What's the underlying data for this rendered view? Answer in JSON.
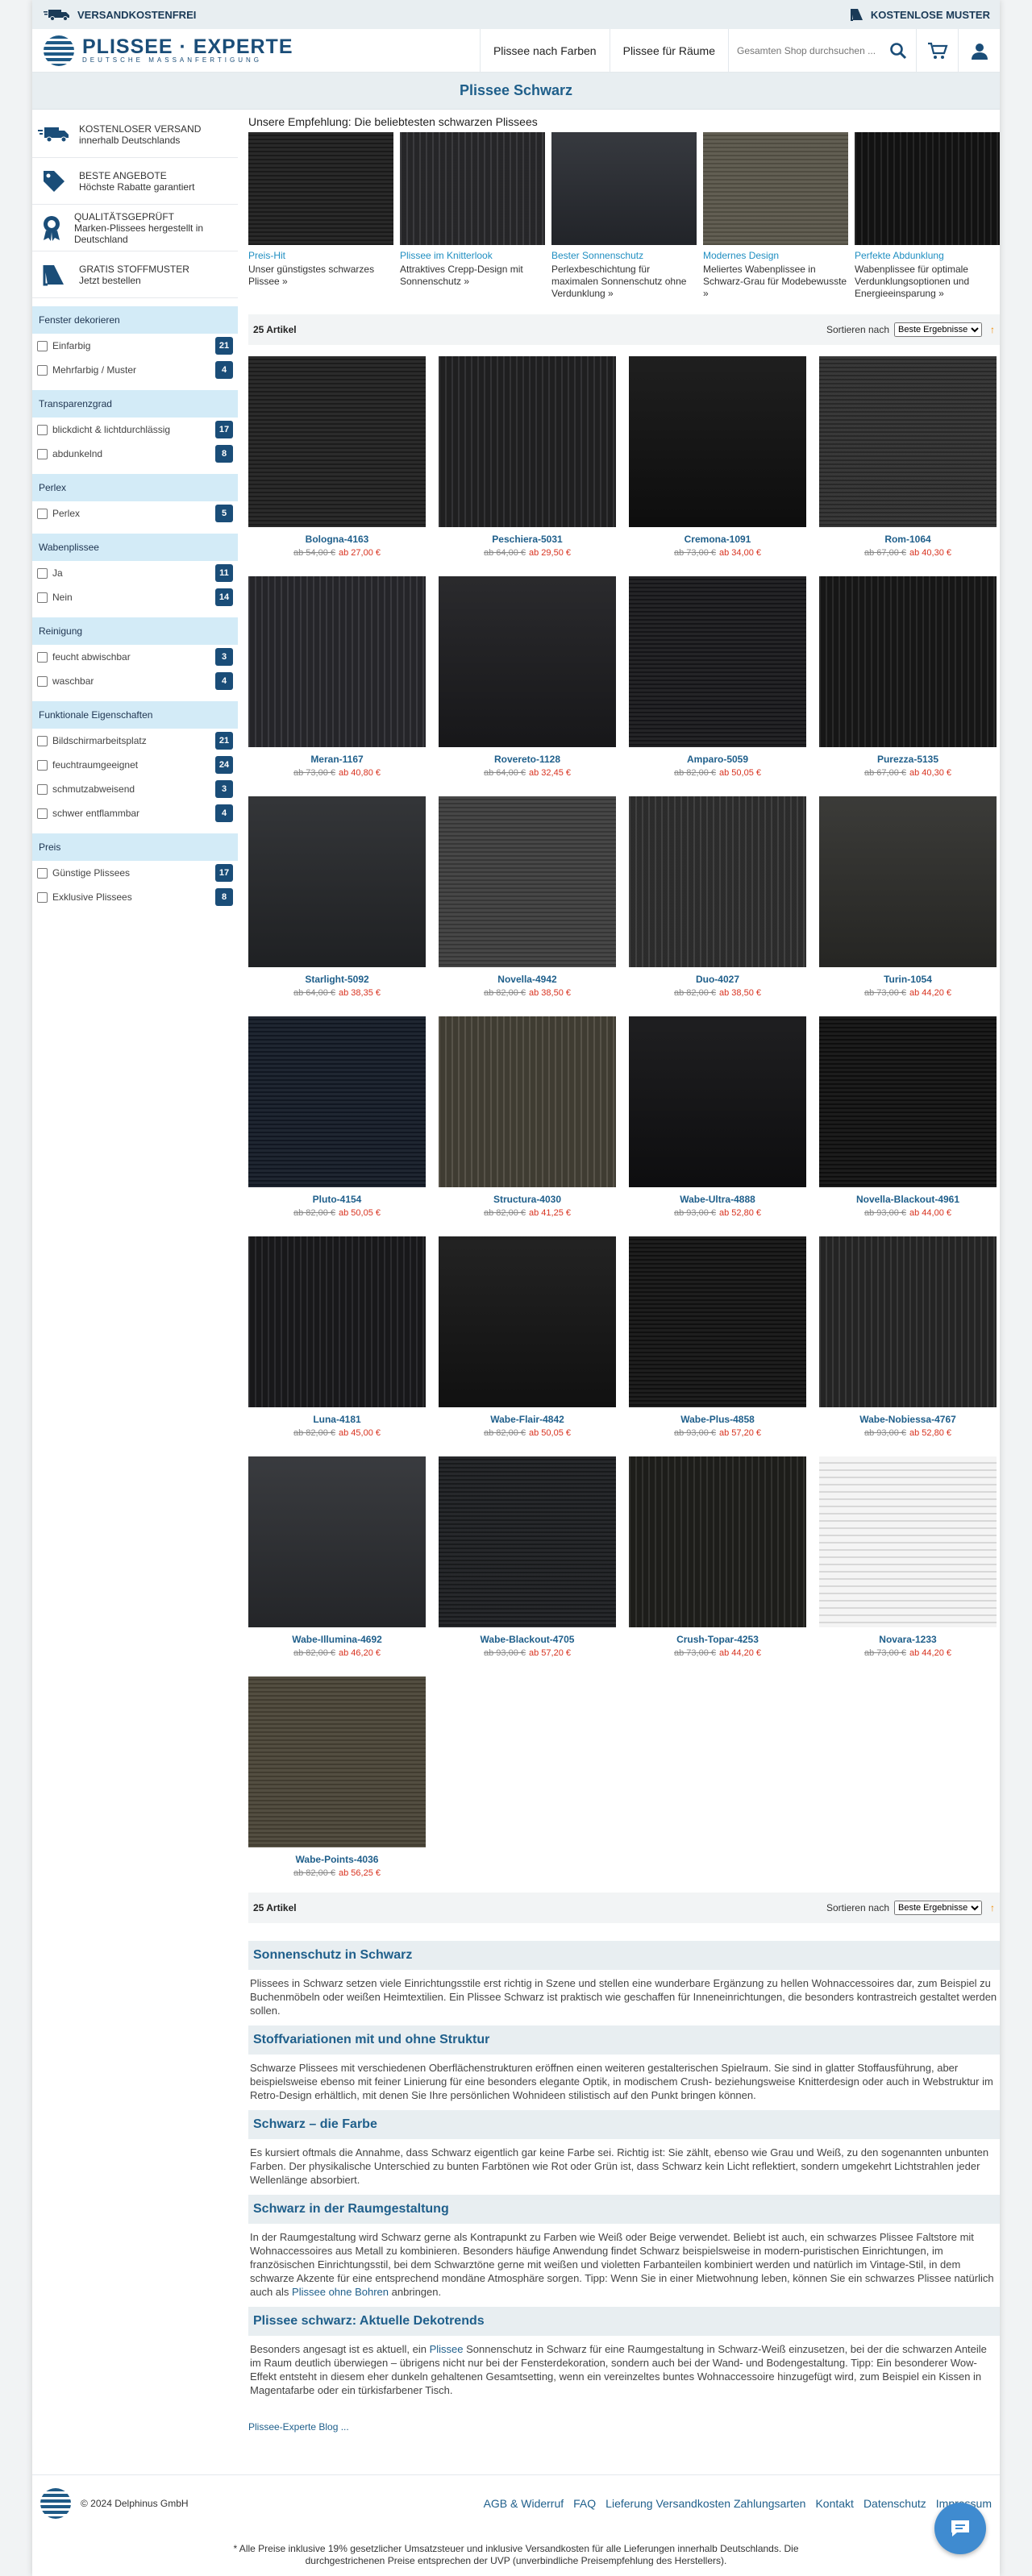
{
  "topbar": {
    "left": "VERSANDKOSTENFREI",
    "right": "KOSTENLOSE MUSTER"
  },
  "logo": {
    "name": "PLISSEE · EXPERTE",
    "tagline": "DEUTSCHE MASSANFERTIGUNG"
  },
  "nav": {
    "colors": "Plissee nach Farben",
    "rooms": "Plissee für Räume"
  },
  "search": {
    "placeholder": "Gesamten Shop durchsuchen ..."
  },
  "icons": [
    "truck-icon",
    "tag-icon",
    "badge-icon",
    "swatch-book-icon",
    "search-icon",
    "cart-icon",
    "user-icon",
    "chat-icon"
  ],
  "page_title": "Plissee Schwarz",
  "usps": [
    {
      "title": "KOSTENLOSER VERSAND",
      "sub": "innerhalb Deutschlands"
    },
    {
      "title": "BESTE ANGEBOTE",
      "sub": "Höchste Rabatte garantiert"
    },
    {
      "title": "QUALITÄTSGEPRÜFT",
      "sub": "Marken-Plissees hergestellt in Deutschland"
    },
    {
      "title": "GRATIS STOFFMUSTER",
      "sub": "Jetzt bestellen"
    }
  ],
  "filters": [
    {
      "title": "Fenster dekorieren",
      "items": [
        {
          "label": "Einfarbig",
          "count": "21"
        },
        {
          "label": "Mehrfarbig / Muster",
          "count": "4"
        }
      ]
    },
    {
      "title": "Transparenzgrad",
      "items": [
        {
          "label": "blickdicht & lichtdurchlässig",
          "count": "17"
        },
        {
          "label": "abdunkelnd",
          "count": "8"
        }
      ]
    },
    {
      "title": "Perlex",
      "items": [
        {
          "label": "Perlex",
          "count": "5"
        }
      ]
    },
    {
      "title": "Wabenplissee",
      "items": [
        {
          "label": "Ja",
          "count": "11"
        },
        {
          "label": "Nein",
          "count": "14"
        }
      ]
    },
    {
      "title": "Reinigung",
      "items": [
        {
          "label": "feucht abwischbar",
          "count": "3"
        },
        {
          "label": "waschbar",
          "count": "4"
        }
      ]
    },
    {
      "title": "Funktionale Eigenschaften",
      "items": [
        {
          "label": "Bildschirmarbeitsplatz",
          "count": "21"
        },
        {
          "label": "feuchtraumgeeignet",
          "count": "24"
        },
        {
          "label": "schmutzabweisend",
          "count": "3"
        },
        {
          "label": "schwer entflammbar",
          "count": "4"
        }
      ]
    },
    {
      "title": "Preis",
      "items": [
        {
          "label": "Günstige Plissees",
          "count": "17"
        },
        {
          "label": "Exklusive Plissees",
          "count": "8"
        }
      ]
    }
  ],
  "recommend": {
    "heading": "Unsere Empfehlung: Die beliebtesten schwarzen Plissees",
    "items": [
      {
        "title": "Preis-Hit",
        "desc": "Unser günstigstes schwarzes Plissee »",
        "swatch": "#1e1e1e"
      },
      {
        "title": "Plissee im Knitterlook",
        "desc": "Attraktives Crepp-Design mit Sonnenschutz »",
        "swatch": "#2c2c2f"
      },
      {
        "title": "Bester Sonnenschutz",
        "desc": "Perlexbeschichtung für maximalen Sonnenschutz ohne Verdunklung »",
        "swatch": "#2a2d33"
      },
      {
        "title": "Modernes Design",
        "desc": "Meliertes Wabenplissee in Schwarz-Grau für Modebewusste »",
        "swatch": "#5a564a"
      },
      {
        "title": "Perfekte Abdunklung",
        "desc": "Wabenplissee für optimale Verdunklungsoptionen und Energieeinsparung »",
        "swatch": "#151515"
      }
    ]
  },
  "toolbar": {
    "count": "25 Artikel",
    "sort_label": "Sortieren nach",
    "sort_value": "Beste Ergebnisse",
    "arrow": "↑"
  },
  "products": [
    {
      "name": "Bologna-4163",
      "old": "ab 54,00 €",
      "new": "ab 27,00 €",
      "swatch": "#202020"
    },
    {
      "name": "Peschiera-5031",
      "old": "ab 64,00 €",
      "new": "ab 29,50 €",
      "swatch": "#242426"
    },
    {
      "name": "Cremona-1091",
      "old": "ab 73,00 €",
      "new": "ab 34,00 €",
      "swatch": "#111111"
    },
    {
      "name": "Rom-1064",
      "old": "ab 67,00 €",
      "new": "ab 40,30 €",
      "swatch": "#2e2e2e"
    },
    {
      "name": "Meran-1167",
      "old": "ab 73,00 €",
      "new": "ab 40,80 €",
      "swatch": "#2b2b30"
    },
    {
      "name": "Rovereto-1128",
      "old": "ab 64,00 €",
      "new": "ab 32,45 €",
      "swatch": "#1d1d20"
    },
    {
      "name": "Amparo-5059",
      "old": "ab 82,00 €",
      "new": "ab 50,05 €",
      "swatch": "#18181b"
    },
    {
      "name": "Purezza-5135",
      "old": "ab 67,00 €",
      "new": "ab 40,30 €",
      "swatch": "#1a1a1a"
    },
    {
      "name": "Starlight-5092",
      "old": "ab 64,00 €",
      "new": "ab 38,35 €",
      "swatch": "#27292c"
    },
    {
      "name": "Novella-4942",
      "old": "ab 82,00 €",
      "new": "ab 38,50 €",
      "swatch": "#3d3d3d"
    },
    {
      "name": "Duo-4027",
      "old": "ab 82,00 €",
      "new": "ab 38,50 €",
      "swatch": "#333333"
    },
    {
      "name": "Turin-1054",
      "old": "ab 73,00 €",
      "new": "ab 44,20 €",
      "swatch": "#2f2f2c"
    },
    {
      "name": "Pluto-4154",
      "old": "ab 82,00 €",
      "new": "ab 50,05 €",
      "swatch": "#131a26"
    },
    {
      "name": "Structura-4030",
      "old": "ab 82,00 €",
      "new": "ab 41,25 €",
      "swatch": "#4a463b"
    },
    {
      "name": "Wabe-Ultra-4888",
      "old": "ab 93,00 €",
      "new": "ab 52,80 €",
      "swatch": "#111113"
    },
    {
      "name": "Novella-Blackout-4961",
      "old": "ab 93,00 €",
      "new": "ab 44,00 €",
      "swatch": "#101010"
    },
    {
      "name": "Luna-4181",
      "old": "ab 82,00 €",
      "new": "ab 45,00 €",
      "swatch": "#1c1c1f"
    },
    {
      "name": "Wabe-Flair-4842",
      "old": "ab 82,00 €",
      "new": "ab 50,05 €",
      "swatch": "#151515"
    },
    {
      "name": "Wabe-Plus-4858",
      "old": "ab 93,00 €",
      "new": "ab 57,20 €",
      "swatch": "#121212"
    },
    {
      "name": "Wabe-Nobiessa-4767",
      "old": "ab 93,00 €",
      "new": "ab 52,80 €",
      "swatch": "#2a2a2a"
    },
    {
      "name": "Wabe-Illumina-4692",
      "old": "ab 82,00 €",
      "new": "ab 46,20 €",
      "swatch": "#2d2f33"
    },
    {
      "name": "Wabe-Blackout-4705",
      "old": "ab 93,00 €",
      "new": "ab 57,20 €",
      "swatch": "#1b1d20"
    },
    {
      "name": "Crush-Topar-4253",
      "old": "ab 73,00 €",
      "new": "ab 44,20 €",
      "swatch": "#22221f"
    },
    {
      "name": "Novara-1233",
      "old": "ab 73,00 €",
      "new": "ab 44,20 €",
      "swatch": "#e8e8e8"
    },
    {
      "name": "Wabe-Points-4036",
      "old": "ab 82,00 €",
      "new": "ab 56,25 €",
      "swatch": "#4a4437"
    }
  ],
  "sections": [
    {
      "title": "Sonnenschutz in Schwarz",
      "text": "Plissees in Schwarz setzen viele Einrichtungsstile erst richtig in Szene und stellen eine wunderbare Ergänzung zu hellen Wohnaccessoires dar, zum Beispiel zu Buchenmöbeln oder weißen Heimtextilien. Ein Plissee Schwarz ist praktisch wie geschaffen für Inneneinrichtungen, die besonders kontrastreich gestaltet werden sollen."
    },
    {
      "title": "Stoffvariationen mit und ohne Struktur",
      "text": "Schwarze Plissees mit verschiedenen Oberflächenstrukturen eröffnen einen weiteren gestalterischen Spielraum. Sie sind in glatter Stoffausführung, aber beispielsweise ebenso mit feiner Linierung für eine besonders elegante Optik, in modischem Crush- beziehungsweise Knitterdesign oder auch in Webstruktur im Retro-Design erhältlich, mit denen Sie Ihre persönlichen Wohnideen stilistisch auf den Punkt bringen können."
    },
    {
      "title": "Schwarz – die Farbe",
      "text": "Es kursiert oftmals die Annahme, dass Schwarz eigentlich gar keine Farbe sei. Richtig ist: Sie zählt, ebenso wie Grau und Weiß, zu den sogenannten unbunten Farben. Der physikalische Unterschied zu bunten Farbtönen wie Rot oder Grün ist, dass Schwarz kein Licht reflektiert, sondern umgekehrt Lichtstrahlen jeder Wellenlänge absorbiert."
    },
    {
      "title": "Schwarz in der Raumgestaltung",
      "text_a": "In der Raumgestaltung wird Schwarz gerne als Kontrapunkt zu Farben wie Weiß oder Beige verwendet. Beliebt ist auch, ein schwarzes Plissee Faltstore mit Wohnaccessoires aus Metall zu kombinieren. Besonders häufige Anwendung findet Schwarz beispielsweise in modern-puristischen Einrichtungen, im französischen Einrichtungsstil, bei dem Schwarztöne gerne mit weißen und violetten Farbanteilen kombiniert werden und natürlich im Vintage-Stil, in dem schwarze Akzente für eine entsprechend mondäne Atmosphäre sorgen. Tipp: Wenn Sie in einer Mietwohnung leben, können Sie ein schwarzes Plissee natürlich auch als",
      "link": "Plissee ohne Bohren",
      "text_b": "anbringen."
    },
    {
      "title": "Plissee schwarz: Aktuelle Dekotrends",
      "text_a": "Besonders angesagt ist es aktuell, ein",
      "link": "Plissee",
      "text_b": "Sonnenschutz in Schwarz für eine Raumgestaltung in Schwarz-Weiß einzusetzen, bei der die schwarzen Anteile im Raum deutlich überwiegen – übrigens nicht nur bei der Fensterdekoration, sondern auch bei der Wand- und Bodengestaltung. Tipp: Ein besonderer Wow-Effekt entsteht in diesem eher dunkeln gehaltenen Gesamtsetting, wenn ein vereinzeltes buntes Wohnaccessoire hinzugefügt wird, zum Beispiel ein Kissen in Magentafarbe oder ein türkisfarbener Tisch."
    }
  ],
  "blog_link": "Plissee-Experte Blog ...",
  "footer": {
    "copyright": "© 2024 Delphinus GmbH",
    "links": [
      "AGB & Widerruf",
      "FAQ",
      "Lieferung Versandkosten Zahlungsarten",
      "Kontakt",
      "Datenschutz",
      "Impressum"
    ],
    "legal_1": "* Alle Preise inklusive 19% gesetzlicher Umsatzsteuer und inklusive Versandkosten für alle Lieferungen innerhalb Deutschlands. Die",
    "legal_2": "durchgestrichenen Preise entsprechen der UVP (unverbindliche Preisempfehlung des Herstellers)."
  },
  "colors": {
    "brand": "#1a4d78",
    "link": "#1f5f8b",
    "accent_link": "#1f8ec1",
    "price": "#d8321f",
    "filter_head": "#d3ebf7",
    "bar": "#e8eef1"
  }
}
